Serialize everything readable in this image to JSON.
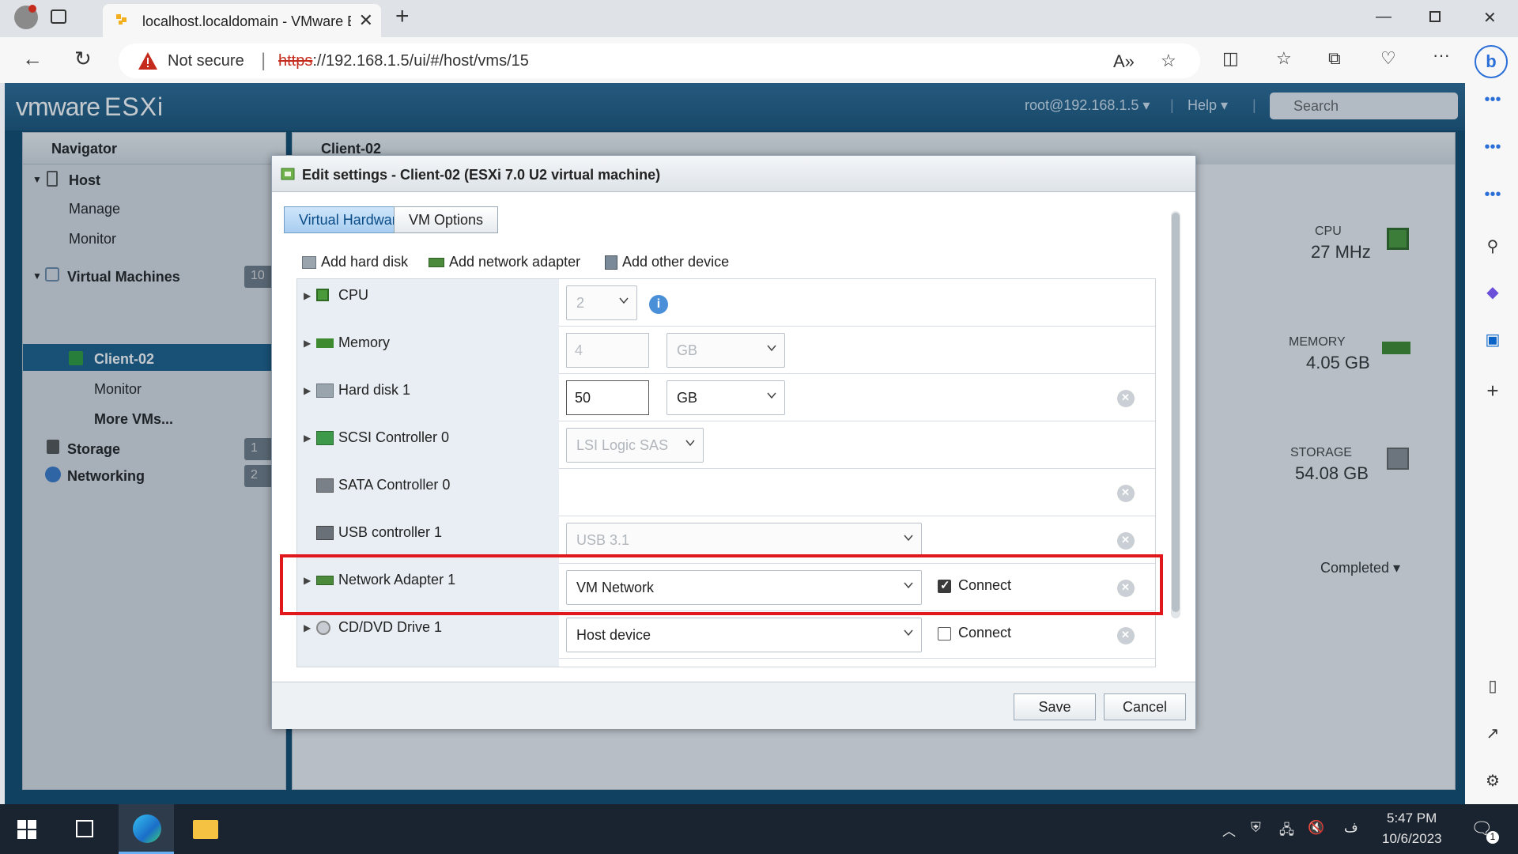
{
  "browser": {
    "tab_title": "localhost.localdomain - VMware E",
    "not_secure": "Not secure",
    "url_protocol": "https",
    "url_rest": "://192.168.1.5/ui/#/host/vms/15"
  },
  "esxi": {
    "logo_vm": "vmware",
    "logo_esxi": "ESXi",
    "user": "root@192.168.1.5 ▾",
    "help": "Help ▾",
    "search_placeholder": "Search"
  },
  "navigator": {
    "title": "Navigator",
    "host": "Host",
    "manage": "Manage",
    "monitor": "Monitor",
    "virtual_machines": "Virtual Machines",
    "vm_badge": "10",
    "client": "Client-02",
    "client_monitor": "Monitor",
    "more_vms": "More VMs...",
    "storage": "Storage",
    "storage_badge": "1",
    "networking": "Networking",
    "networking_badge": "2"
  },
  "main": {
    "title": "Client-02",
    "cpu_label": "CPU",
    "cpu_value": "27 MHz",
    "memory_label": "MEMORY",
    "memory_value": "4.05 GB",
    "storage_label": "STORAGE",
    "storage_value": "54.08 GB",
    "completed": "Completed ▾"
  },
  "dialog": {
    "title": "Edit settings - Client-02 (ESXi 7.0 U2 virtual machine)",
    "tab_hw": "Virtual Hardware",
    "tab_opts": "VM Options",
    "add_disk": "Add hard disk",
    "add_net": "Add network adapter",
    "add_other": "Add other device",
    "rows": {
      "cpu": {
        "label": "CPU",
        "value": "2"
      },
      "memory": {
        "label": "Memory",
        "value": "4",
        "unit": "GB"
      },
      "disk": {
        "label": "Hard disk 1",
        "value": "50",
        "unit": "GB"
      },
      "scsi": {
        "label": "SCSI Controller 0",
        "value": "LSI Logic SAS"
      },
      "sata": {
        "label": "SATA Controller 0"
      },
      "usb": {
        "label": "USB controller 1",
        "value": "USB 3.1"
      },
      "net": {
        "label": "Network Adapter 1",
        "value": "VM Network",
        "connect": "Connect"
      },
      "cd": {
        "label": "CD/DVD Drive 1",
        "value": "Host device",
        "connect": "Connect"
      }
    },
    "save": "Save",
    "cancel": "Cancel"
  },
  "taskbar": {
    "time": "5:47 PM",
    "date": "10/6/2023",
    "lang": "ف",
    "notif": "1"
  },
  "colors": {
    "highlight": "#e0181c",
    "esxi_header": "#2b6a94",
    "selected_nav": "#1b5e8a"
  }
}
